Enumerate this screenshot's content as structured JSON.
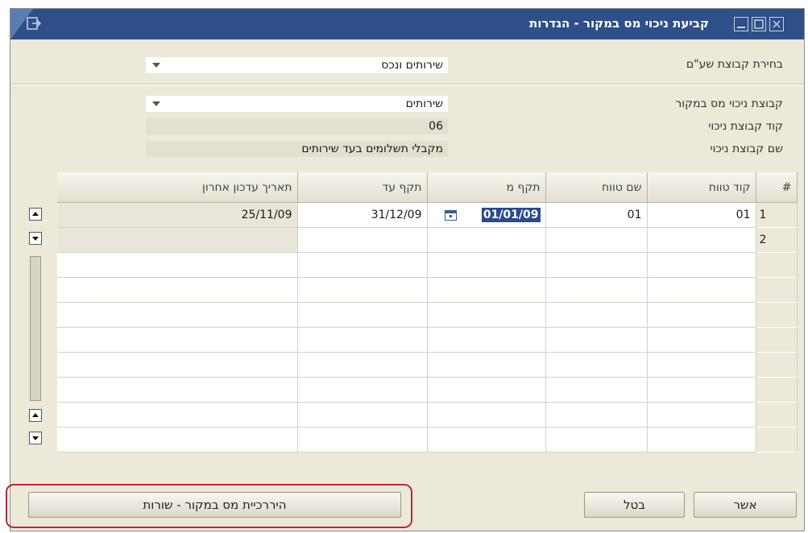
{
  "window": {
    "title": "קביעת ניכוי מס במקור - הגדרות",
    "accent": "#2e4f87"
  },
  "fields": {
    "group_select": {
      "label": "בחירת קבוצת שע\"ם",
      "value": "שירותים ונכס"
    },
    "deduction_group": {
      "label": "קבוצת ניכוי מס במקור",
      "value": "שירותים"
    },
    "group_code": {
      "label": "קוד קבוצת ניכוי",
      "value": "06"
    },
    "group_name": {
      "label": "שם קבוצת ניכוי",
      "value": "מקבלי תשלומים בעד שירותים"
    }
  },
  "table": {
    "headers": [
      "#",
      "קוד טווח",
      "שם טווח",
      "תקף מ",
      "תקף עד",
      "תאריך עדכון אחרון"
    ],
    "rows": [
      {
        "num": "1",
        "code": "01",
        "name": "01",
        "from": "01/01/09",
        "to": "31/12/09",
        "updated": "25/11/09"
      },
      {
        "num": "2",
        "code": "",
        "name": "",
        "from": "",
        "to": "",
        "updated": ""
      }
    ]
  },
  "buttons": {
    "ok": "אשר",
    "cancel": "בטל",
    "hierarchy": "היררכיית מס במקור - שורות"
  }
}
